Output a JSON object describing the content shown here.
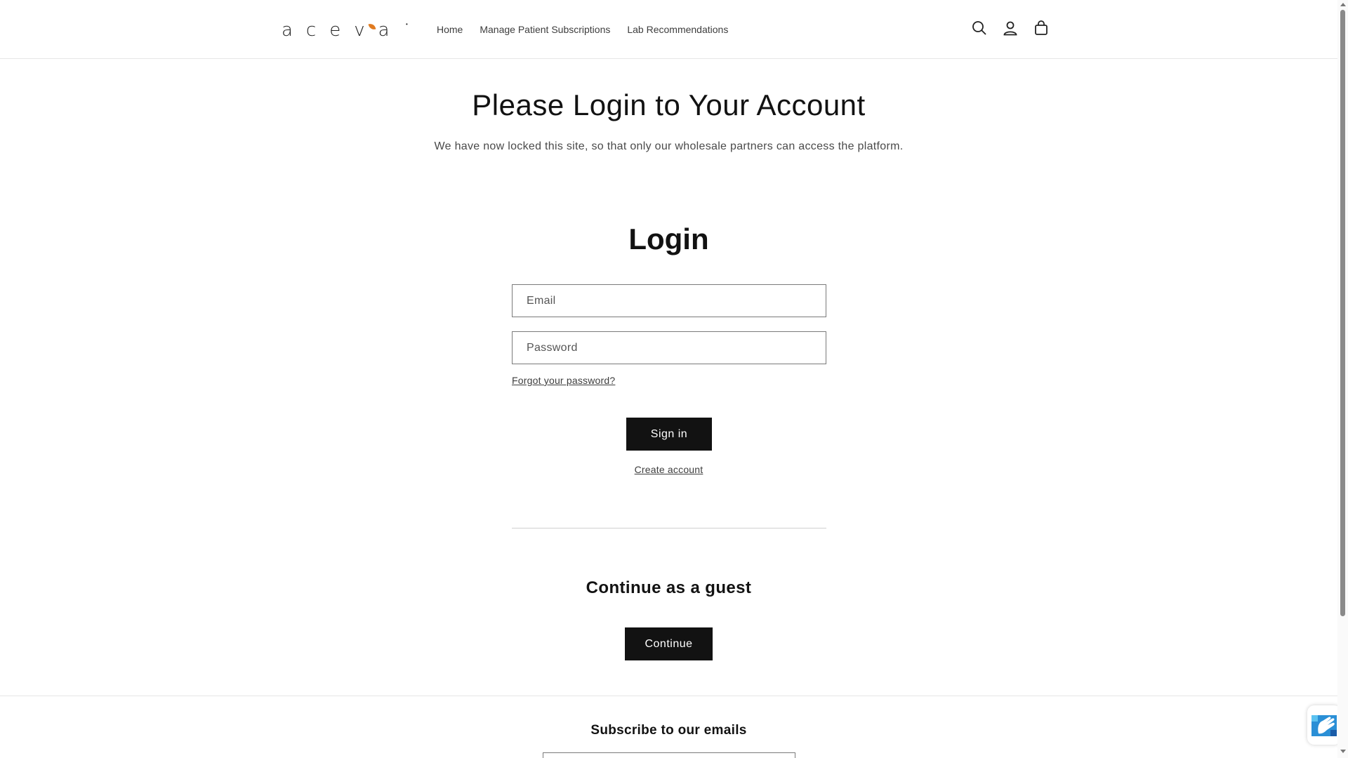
{
  "header": {
    "logo_text": "aceva",
    "nav": [
      {
        "label": "Home"
      },
      {
        "label": "Manage Patient Subscriptions"
      },
      {
        "label": "Lab Recommendations"
      }
    ],
    "icons": [
      "search-icon",
      "account-icon",
      "cart-icon"
    ]
  },
  "main": {
    "title": "Please Login to Your Account",
    "subtitle": "We have now locked this site, so that only our wholesale partners can access the platform.",
    "login": {
      "heading": "Login",
      "email_placeholder": "Email",
      "password_placeholder": "Password",
      "forgot_label": "Forgot your password?",
      "signin_label": "Sign in",
      "create_label": "Create account"
    },
    "guest": {
      "heading": "Continue as a guest",
      "continue_label": "Continue"
    }
  },
  "footer": {
    "subscribe_heading": "Subscribe to our emails"
  },
  "colors": {
    "primary_button": "#121212",
    "logo_accent": "#e07a1f"
  }
}
